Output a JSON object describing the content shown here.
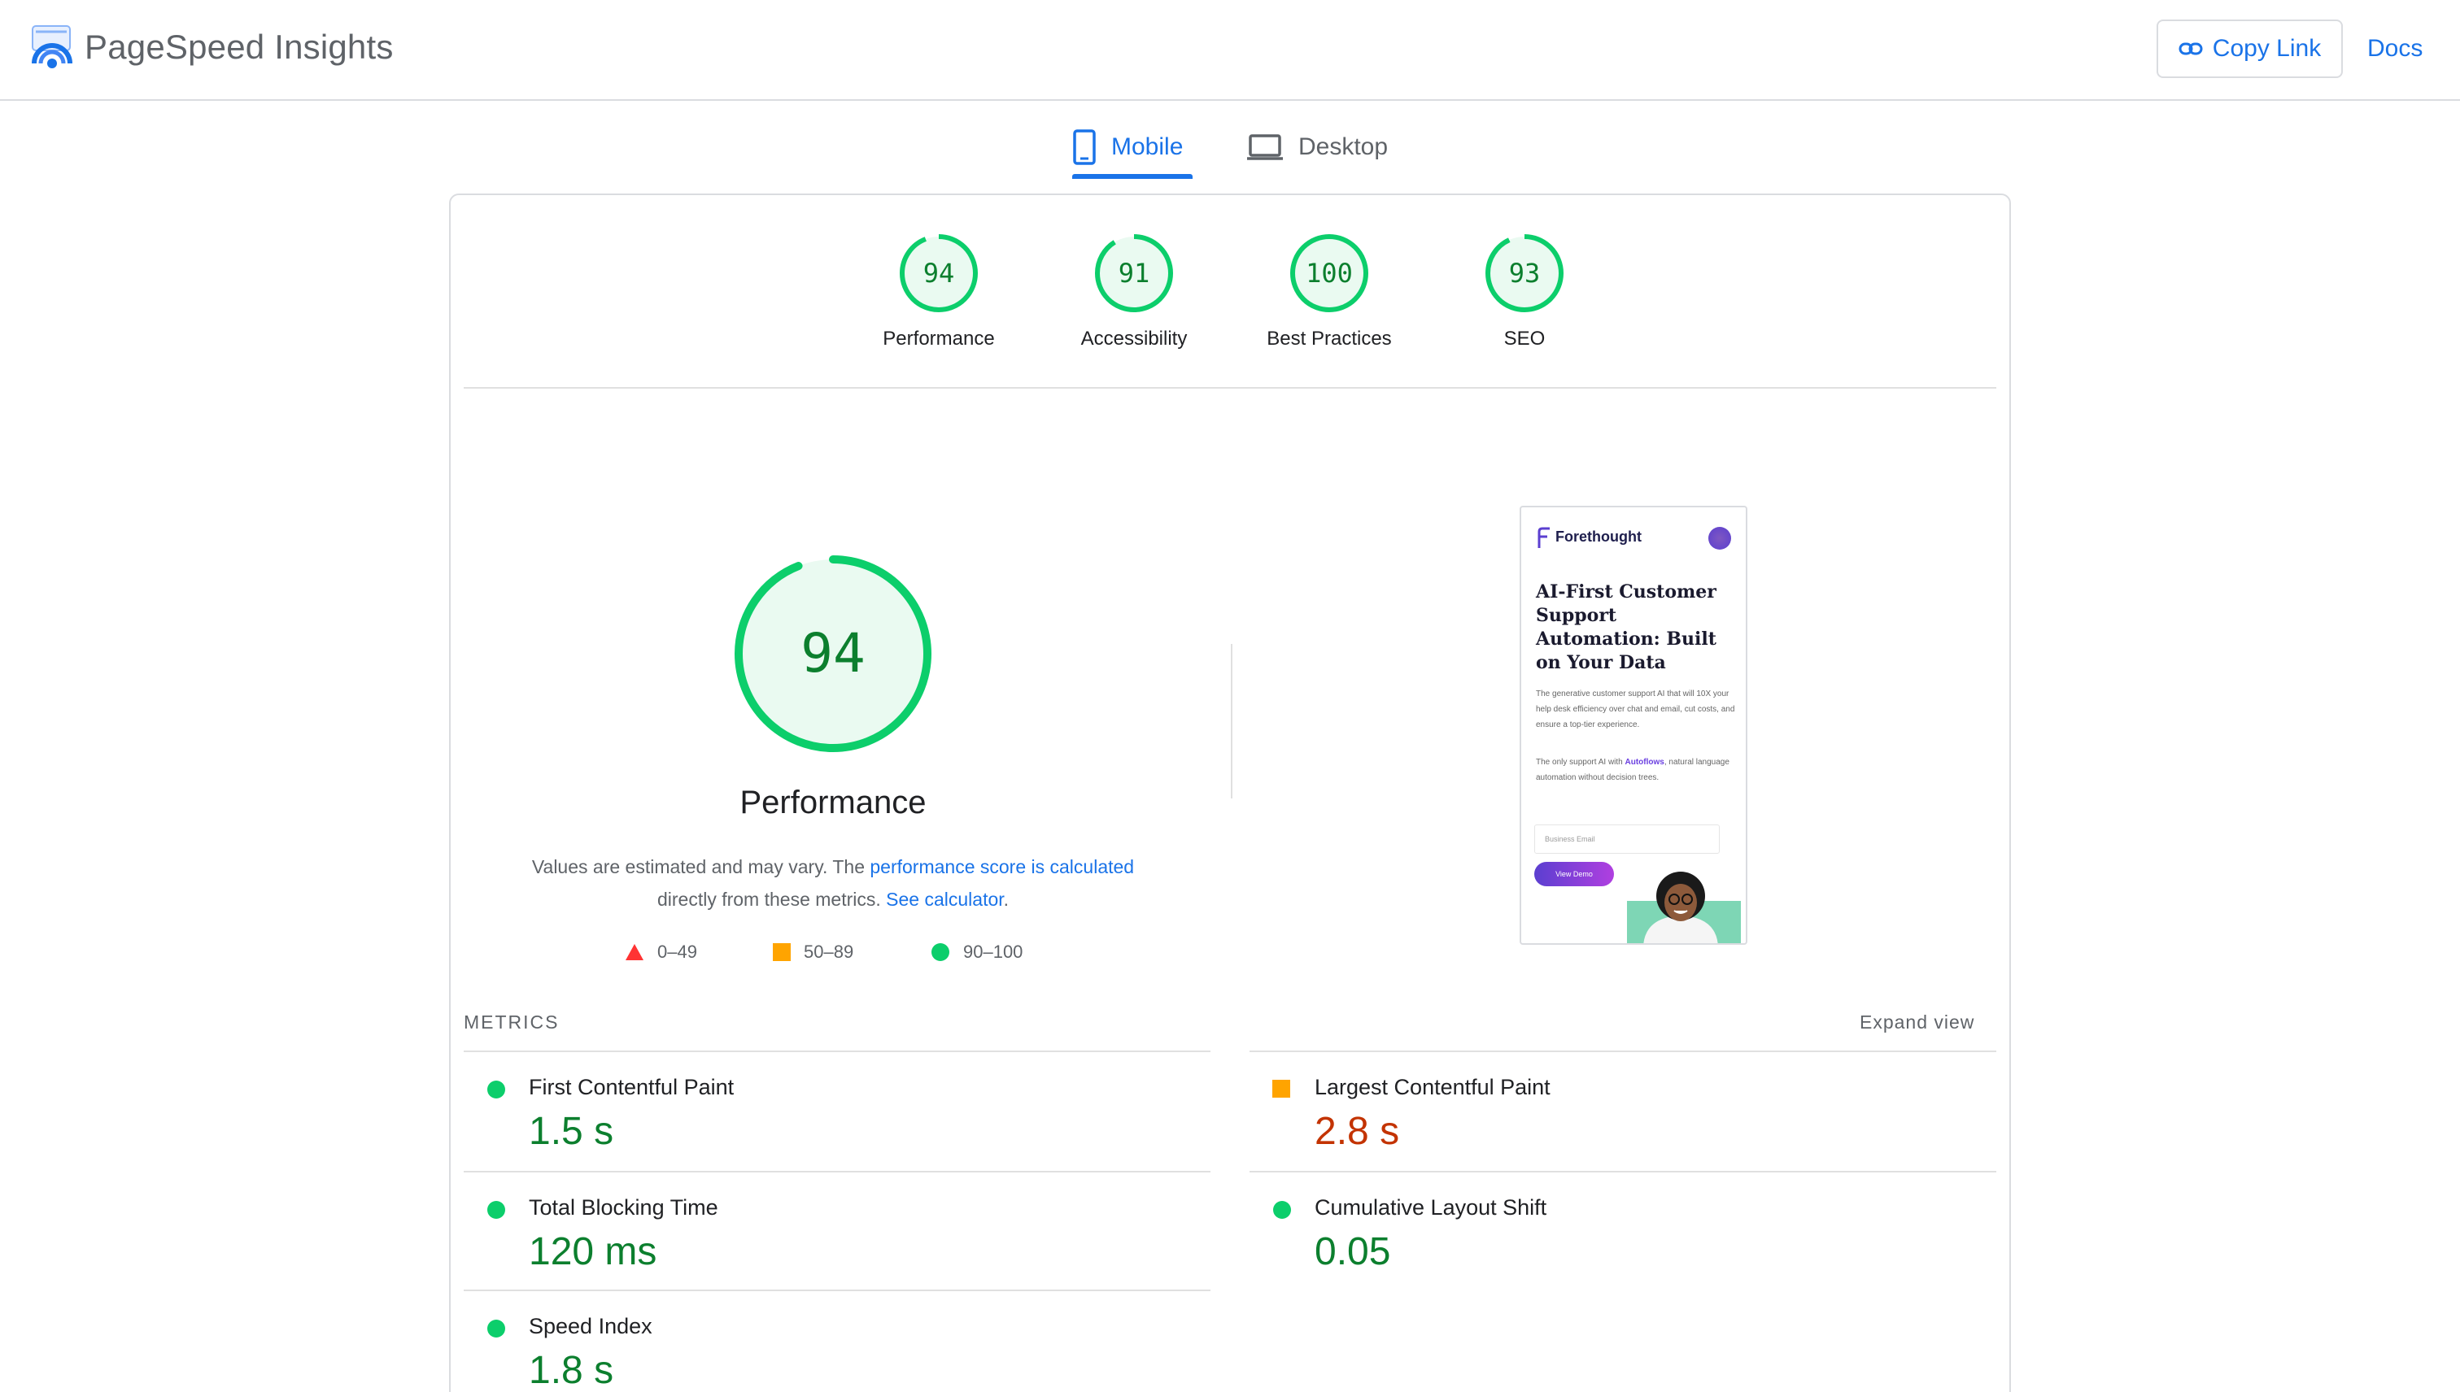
{
  "app": {
    "title": "PageSpeed Insights"
  },
  "header": {
    "copy_link_label": "Copy Link",
    "docs_label": "Docs"
  },
  "tabs": [
    {
      "label": "Mobile",
      "selected": true
    },
    {
      "label": "Desktop",
      "selected": false
    }
  ],
  "categories": [
    {
      "label": "Performance",
      "score": "94"
    },
    {
      "label": "Accessibility",
      "score": "91"
    },
    {
      "label": "Best Practices",
      "score": "100"
    },
    {
      "label": "SEO",
      "score": "93"
    }
  ],
  "performance": {
    "score": "94",
    "title": "Performance",
    "desc_prefix": "Values are estimated and may vary. The ",
    "desc_link1": "performance score is calculated",
    "desc_middle": "directly from these metrics. ",
    "desc_link2": "See calculator",
    "desc_suffix": "."
  },
  "legend": [
    {
      "range": "0–49",
      "shape": "triangle",
      "color": "#ff3333"
    },
    {
      "range": "50–89",
      "shape": "square",
      "color": "#ffa400"
    },
    {
      "range": "90–100",
      "shape": "circle",
      "color": "#0cce6b"
    }
  ],
  "screenshot": {
    "brand": "Forethought",
    "headline": "AI-First Customer Support Automation: Built on Your Data",
    "paragraph1": "The generative customer support AI that will 10X your help desk efficiency over chat and email, cut costs, and ensure a top-tier experience.",
    "paragraph2_prefix": "The only support AI with ",
    "paragraph2_bold": "Autoflows",
    "paragraph2_suffix": ", natural language automation without decision trees.",
    "input_placeholder": "Business Email",
    "button_label": "View Demo"
  },
  "metrics": {
    "title": "METRICS",
    "expand_label": "Expand view",
    "items": [
      {
        "label": "First Contentful Paint",
        "value": "1.5 s",
        "rating": "good"
      },
      {
        "label": "Largest Contentful Paint",
        "value": "2.8 s",
        "rating": "average"
      },
      {
        "label": "Total Blocking Time",
        "value": "120 ms",
        "rating": "good"
      },
      {
        "label": "Cumulative Layout Shift",
        "value": "0.05",
        "rating": "good"
      },
      {
        "label": "Speed Index",
        "value": "1.8 s",
        "rating": "good"
      }
    ]
  },
  "colors": {
    "good": "#0cce6b",
    "good_text": "#0c7f2e",
    "average": "#ffa400",
    "average_text": "#c33300",
    "link": "#1a73e8"
  }
}
